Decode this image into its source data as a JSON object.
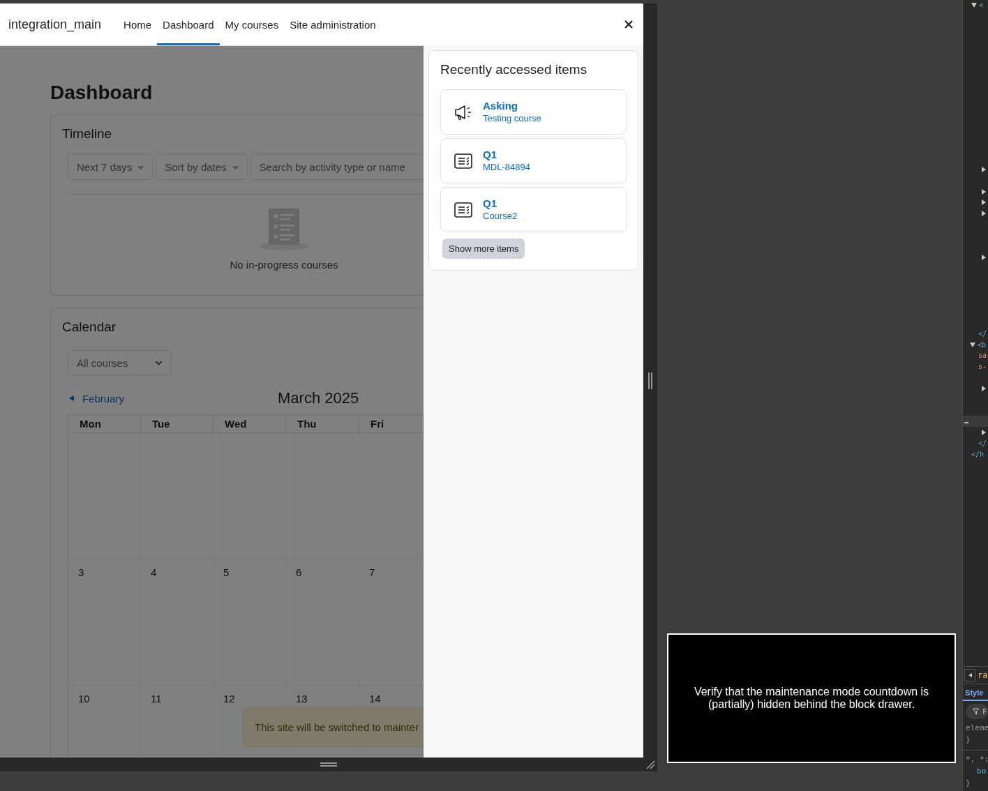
{
  "navbar": {
    "site_name": "integration_main",
    "links": [
      {
        "label": "Home",
        "selected": false
      },
      {
        "label": "Dashboard",
        "selected": true
      },
      {
        "label": "My courses",
        "selected": false
      },
      {
        "label": "Site administration",
        "selected": false
      }
    ]
  },
  "page_title": "Dashboard",
  "timeline": {
    "title": "Timeline",
    "filters": [
      {
        "label": "Next 7 days"
      },
      {
        "label": "Sort by dates"
      }
    ],
    "search": {
      "placeholder": "Search by activity type or name"
    },
    "empty_message": "No in-progress courses"
  },
  "calendar": {
    "title": "Calendar",
    "course_filter": "All courses",
    "prev_month": "February",
    "month": "March 2025",
    "weekdays": [
      "Mon",
      "Tue",
      "Wed",
      "Thu",
      "Fri"
    ],
    "weeks": [
      {
        "kind": "blank"
      },
      {
        "kind": "days",
        "days": [
          "3",
          "4",
          "5",
          "6",
          "7"
        ]
      },
      {
        "kind": "days",
        "days": [
          "10",
          "11",
          "12",
          "13",
          "14"
        ]
      }
    ]
  },
  "maintenance_alert": "This site will be switched to mainter",
  "drawer": {
    "title": "Recently accessed items",
    "items": [
      {
        "kind": "announcement",
        "name": "Asking",
        "course": "Testing course"
      },
      {
        "kind": "quiz",
        "name": "Q1",
        "course": "MDL-84894"
      },
      {
        "kind": "quiz",
        "name": "Q1",
        "course": "Course2"
      }
    ],
    "more_button": "Show more items"
  },
  "test_note": "Verify that the maintenance mode countdown is (partially) hidden behind the block drawer.",
  "devtools": {
    "dom_rows": [
      {
        "kind": "tag",
        "text": "<",
        "expanded": true
      },
      {
        "kind": "toggle",
        "expanded": false
      },
      {
        "kind": "toggle",
        "expanded": false
      },
      {
        "kind": "toggle",
        "expanded": false
      },
      {
        "kind": "toggle",
        "expanded": false
      },
      {
        "kind": "toggle",
        "expanded": false
      },
      {
        "kind": "tag",
        "text": "</"
      },
      {
        "kind": "tag",
        "text": "<b",
        "expanded": true
      },
      {
        "kind": "attr",
        "text": "sa"
      },
      {
        "kind": "attr",
        "text": "s-"
      },
      {
        "kind": "toggle",
        "expanded": false
      },
      {
        "kind": "ellipsis",
        "text": "…"
      },
      {
        "kind": "toggle",
        "expanded": false
      },
      {
        "kind": "tag",
        "text": "</"
      },
      {
        "kind": "tag",
        "text": "</h"
      }
    ],
    "toolbar_text": "ra",
    "tabs": [
      {
        "label": "Style",
        "selected": true
      }
    ],
    "filter_placeholder": "F",
    "style_lines": [
      {
        "kind": "plain",
        "text": "eleme"
      },
      {
        "kind": "plain",
        "text": "}"
      },
      {
        "kind": "selector",
        "text": "*, *:"
      },
      {
        "kind": "prop",
        "text": "bo"
      },
      {
        "kind": "plain",
        "text": "}"
      }
    ]
  }
}
